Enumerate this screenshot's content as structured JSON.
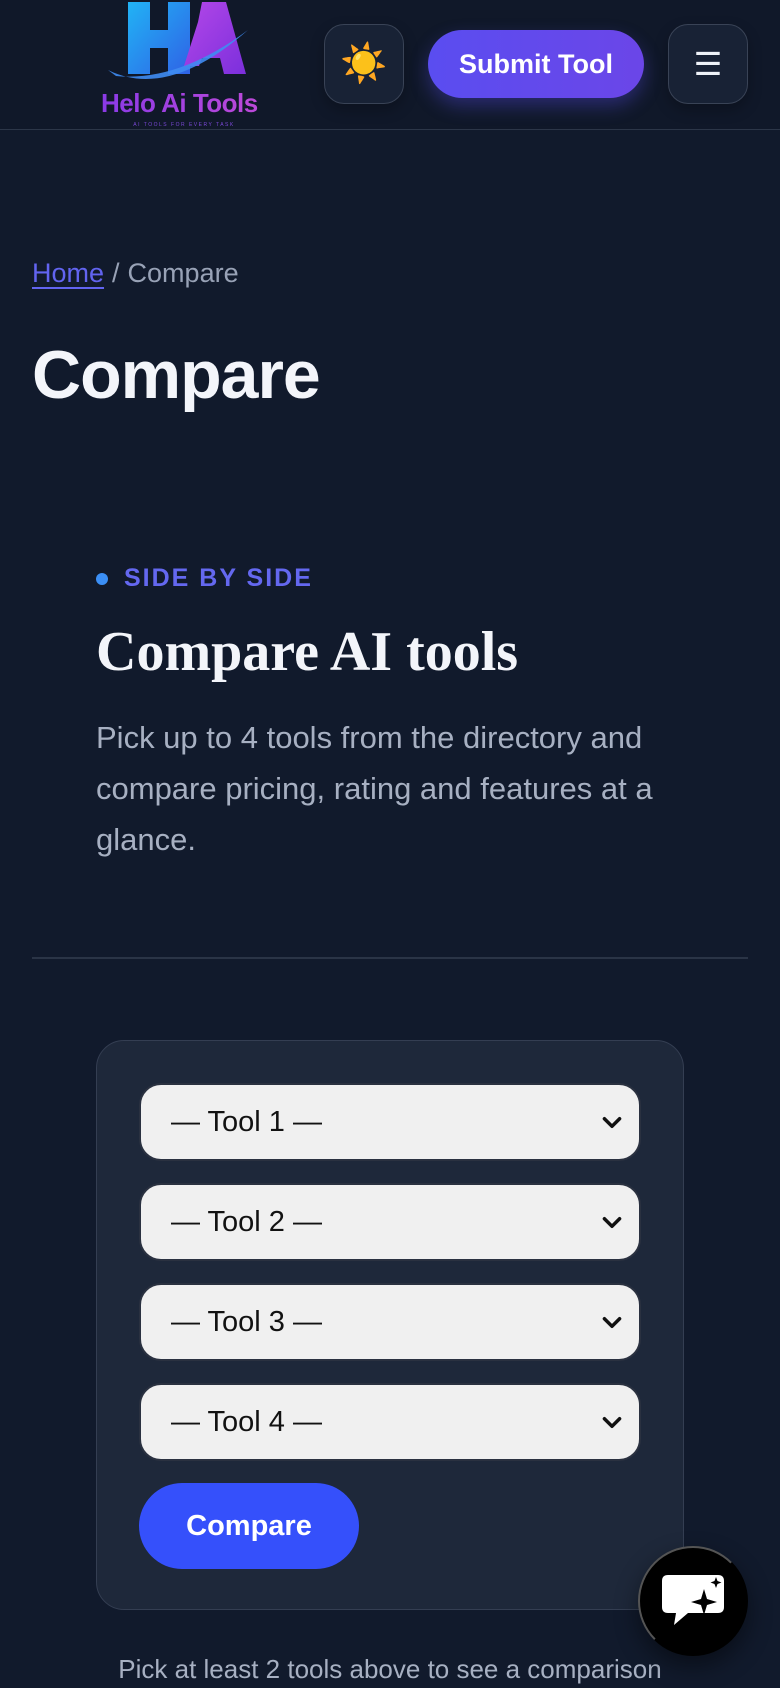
{
  "header": {
    "logo_text": "Helo Ai Tools",
    "logo_tagline": "AI TOOLS FOR EVERY TASK",
    "theme_icon": "sun-icon",
    "theme_glyph": "☀️",
    "submit_label": "Submit Tool",
    "menu_icon": "hamburger-menu-icon",
    "menu_glyph": "☰"
  },
  "breadcrumb": {
    "home": "Home",
    "separator": "/",
    "current": "Compare"
  },
  "page_title": "Compare",
  "intro": {
    "eyebrow": "SIDE BY SIDE",
    "title": "Compare AI tools",
    "description": "Pick up to 4 tools from the directory and compare pricing, rating and features at a glance."
  },
  "compare_form": {
    "selects": [
      {
        "value": "— Tool 1 —"
      },
      {
        "value": "— Tool 2 —"
      },
      {
        "value": "— Tool 3 —"
      },
      {
        "value": "— Tool 4 —"
      }
    ],
    "button_label": "Compare"
  },
  "hint": "Pick at least 2 tools above to see a comparison",
  "chat": {
    "icon": "chat-sparkle-icon"
  },
  "colors": {
    "background": "#111a2c",
    "accent": "#6468f0",
    "primary_button": "#3550fb",
    "card": "#1e283a"
  }
}
